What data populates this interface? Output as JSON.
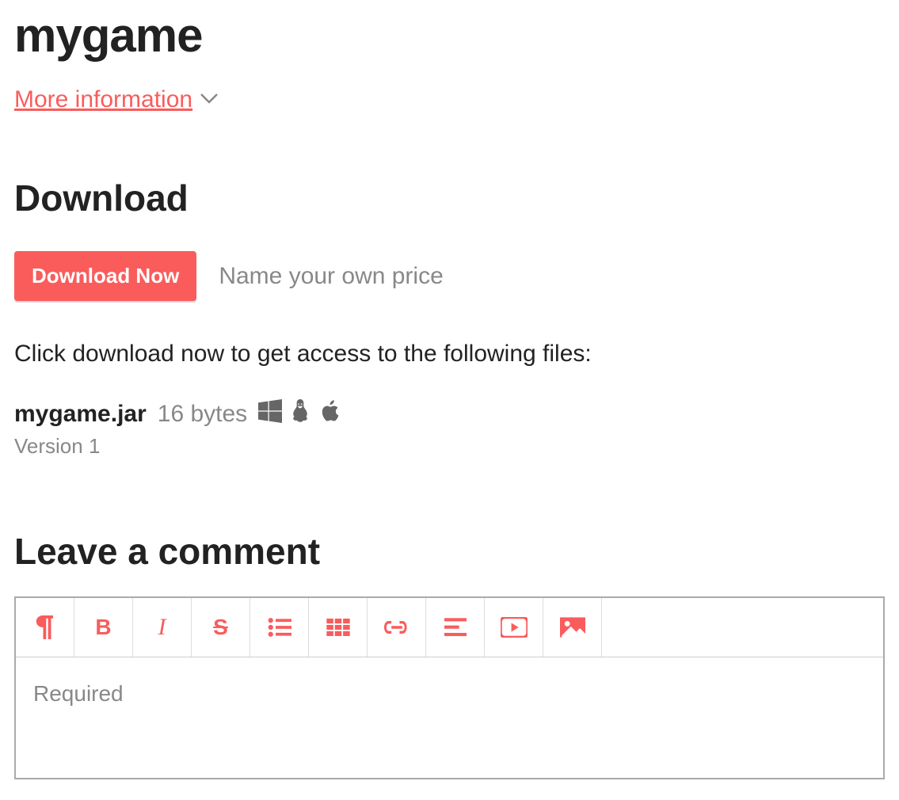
{
  "title": "mygame",
  "moreInfo": {
    "label": "More information"
  },
  "download": {
    "heading": "Download",
    "buttonLabel": "Download Now",
    "priceLabel": "Name your own price",
    "description": "Click download now to get access to the following files:",
    "file": {
      "name": "mygame.jar",
      "size": "16 bytes",
      "version": "Version 1",
      "platforms": [
        "windows",
        "linux",
        "apple"
      ]
    }
  },
  "comment": {
    "heading": "Leave a comment",
    "placeholder": "Required",
    "tools": [
      "paragraph",
      "bold",
      "italic",
      "strike",
      "bullet-list",
      "grid",
      "link",
      "align",
      "video",
      "image"
    ]
  }
}
